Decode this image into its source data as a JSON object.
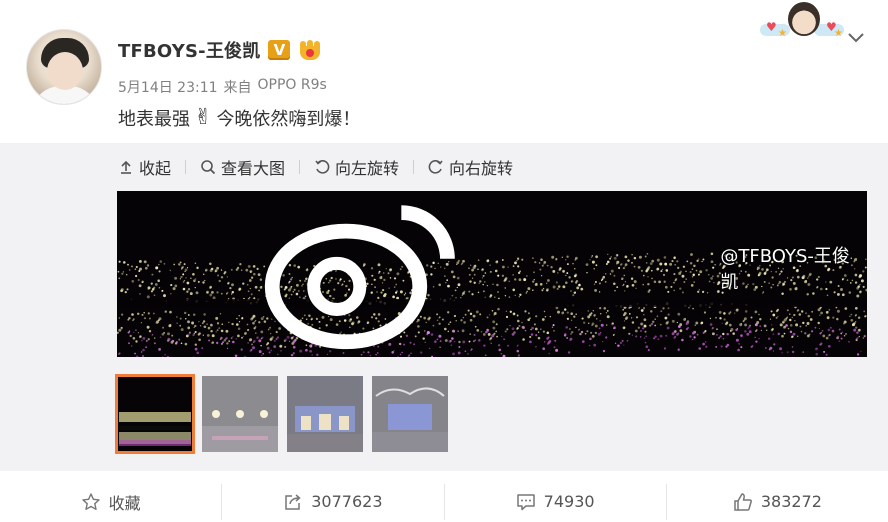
{
  "post": {
    "user_name": "TFBOYS-王俊凯",
    "verified_badge": "V",
    "timestamp": "5月14日 23:11",
    "source_prefix": "来自",
    "source_device": "OPPO R9s",
    "text_before": "地表最强",
    "emoji": "✌",
    "text_after": "今晚依然嗨到爆！"
  },
  "media_toolbar": {
    "collapse": "收起",
    "view_large": "查看大图",
    "rotate_left": "向左旋转",
    "rotate_right": "向右旋转"
  },
  "main_photo": {
    "watermark": "@TFBOYS-王俊凯"
  },
  "thumbnails": [
    {
      "name": "thumb-1",
      "active": true
    },
    {
      "name": "thumb-2",
      "active": false
    },
    {
      "name": "thumb-3",
      "active": false
    },
    {
      "name": "thumb-4",
      "active": false
    }
  ],
  "actions": {
    "favorite_label": "收藏",
    "repost_count": "3077623",
    "comment_count": "74930",
    "like_count": "383272"
  },
  "colors": {
    "accent_orange": "#ee7d3a",
    "badge_gold": "#e8a116",
    "panel_bg": "#f2f2f5"
  },
  "icons": [
    "more-chevron-icon",
    "collapse-icon",
    "zoom-icon",
    "rotate-left-icon",
    "rotate-right-icon",
    "star-icon",
    "repost-icon",
    "comment-icon",
    "like-icon",
    "weibo-logo-icon"
  ]
}
